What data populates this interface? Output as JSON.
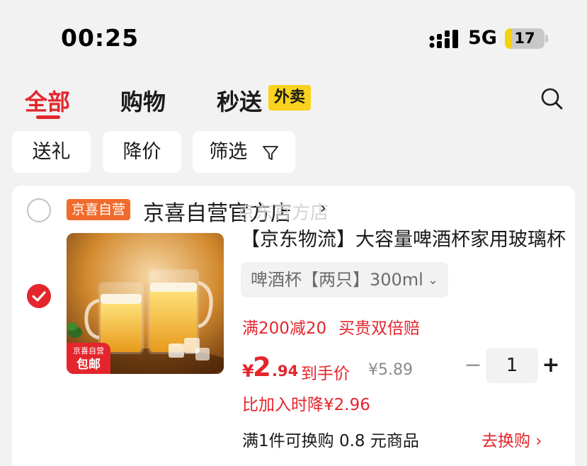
{
  "status_bar": {
    "time": "00:25",
    "network": "5G",
    "battery": "17",
    "battery_level": 0.17
  },
  "tabs": [
    {
      "label": "全部",
      "active": true
    },
    {
      "label": "购物",
      "active": false
    },
    {
      "label": "秒送",
      "active": false,
      "badge": "外卖"
    }
  ],
  "icons": {
    "search": "search-icon",
    "filter": "filter-icon",
    "checked": "check-icon"
  },
  "filters": [
    {
      "label": "送礼"
    },
    {
      "label": "降价"
    },
    {
      "label": "筛选",
      "icon": "filter-icon"
    }
  ],
  "shop": {
    "tag": "京喜自营",
    "name": "京喜自营官方店",
    "chevron": "›",
    "watermark": "京东官方店"
  },
  "product": {
    "image_badge_top": "京喜自营",
    "image_badge_bottom": "包邮",
    "title": "【京东物流】大容量啤酒杯家用玻璃杯",
    "spec": "啤酒杯【两只】300ml",
    "promos": [
      "满200减20",
      "买贵双倍赔"
    ],
    "price_symbol": "¥",
    "price_int": "2",
    "price_dec": ".94",
    "price_label": "到手价",
    "price_original": "¥5.89",
    "quantity": "1",
    "minus": "−",
    "plus": "+",
    "price_drop": "比加入时降¥2.96",
    "exchange_text": "满1件可换购 0.8 元商品",
    "exchange_link": "去换购 ›"
  },
  "colors": {
    "accent": "#e4252c",
    "shop_tag": "#f06b2c",
    "waimai_badge": "#f8d21c",
    "background": "#f2f2f2"
  }
}
